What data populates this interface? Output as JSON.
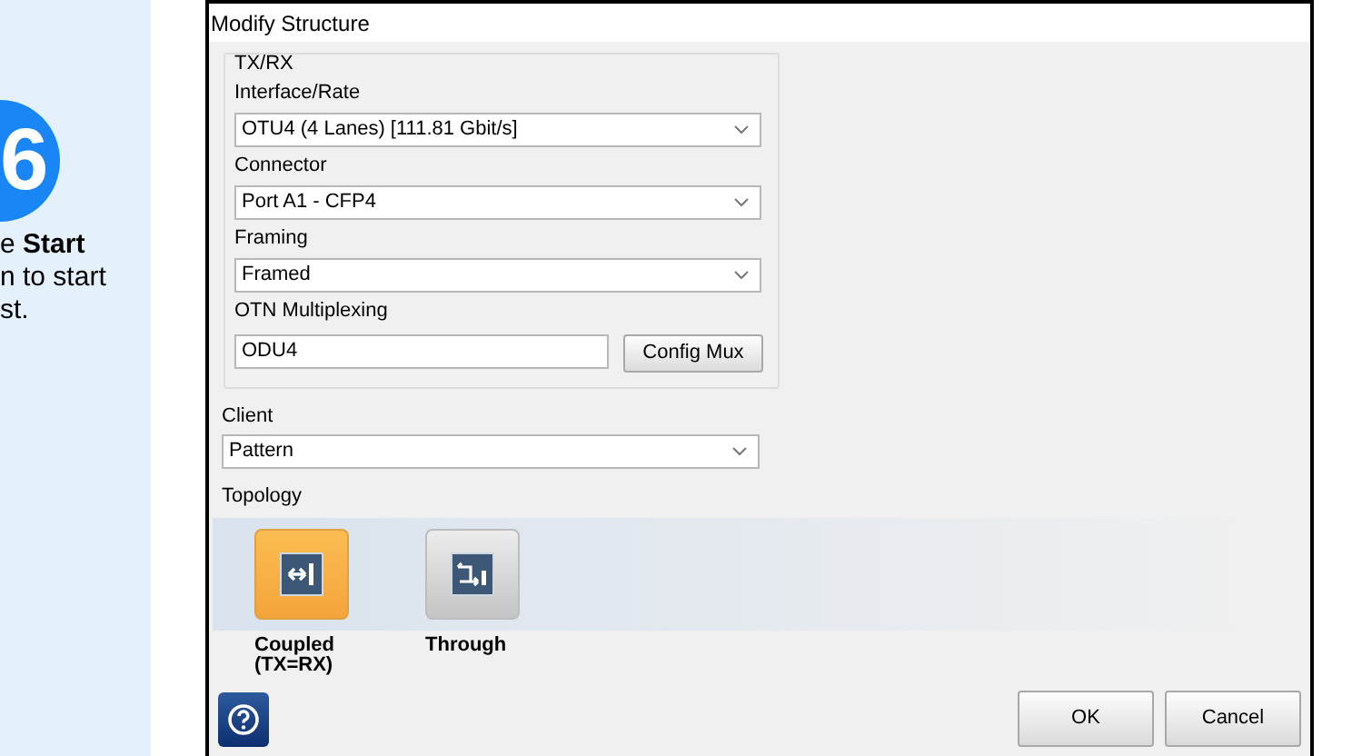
{
  "side_panel": {
    "step_number": "6",
    "lines": [
      "e **Start**",
      "n to start",
      "st."
    ]
  },
  "dialog": {
    "title": "Modify Structure",
    "group": {
      "title": "TX/RX",
      "fields": [
        {
          "kind": "select",
          "label": "Interface/Rate",
          "value": "OTU4 (4 Lanes) [111.81 Gbit/s]"
        },
        {
          "kind": "select",
          "label": "Connector",
          "value": "Port A1 - CFP4"
        },
        {
          "kind": "select",
          "label": "Framing",
          "value": "Framed"
        },
        {
          "kind": "input",
          "label": "OTN Multiplexing",
          "value": "ODU4",
          "button": "Config Mux"
        }
      ]
    },
    "client": {
      "label": "Client",
      "value": "Pattern"
    },
    "topology": {
      "label": "Topology",
      "options": [
        {
          "kind": "coupled",
          "label": "Coupled\n(TX=RX)",
          "selected": true
        },
        {
          "kind": "through",
          "label": "Through",
          "selected": false
        }
      ]
    },
    "buttons": [
      "OK",
      "Cancel"
    ]
  }
}
